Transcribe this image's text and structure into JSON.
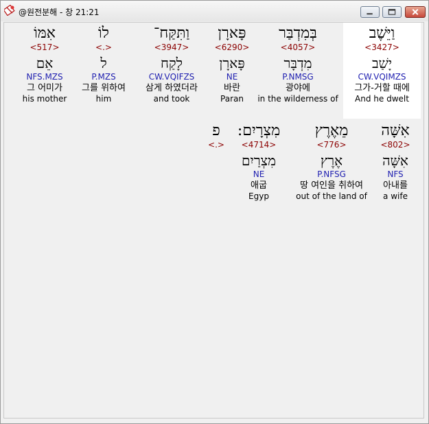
{
  "window": {
    "title": "@원전분해 - 창 21:21",
    "min_icon": "minimize-icon",
    "max_icon": "maximize-icon",
    "close_icon": "close-icon"
  },
  "colors": {
    "strong": "#8b0000",
    "parsing": "#1f1fb0",
    "selected_bg": "#ffffff"
  },
  "rows": [
    {
      "words": [
        {
          "hebrew": "וַיֵּשֶׁב",
          "strong": "<3427>",
          "lemma": "יָשַׁב",
          "parsing": "CW.VQIMZS",
          "korean": "그가-거할 때에",
          "english": "And he dwelt",
          "selected": true
        },
        {
          "hebrew": "בְּמִדְבַּר",
          "strong": "<4057>",
          "lemma": "מִדְבָּר",
          "parsing": "P.NMSG",
          "korean": "광야에",
          "english": "in the wilderness of"
        },
        {
          "hebrew": "פָּארָן",
          "strong": "<6290>",
          "lemma": "פָּארָן",
          "parsing": "NE",
          "korean": "바란",
          "english": "Paran"
        },
        {
          "hebrew": "וַתִּקַּח־",
          "strong": "<3947>",
          "lemma": "לָקַח",
          "parsing": "CW.VQIFZS",
          "korean": "삼게 하였더라",
          "english": "and took"
        },
        {
          "hebrew": "לוֹ",
          "strong": "<.>",
          "lemma": "ל",
          "parsing": "P.MZS",
          "korean": "그를 위하여",
          "english": "him"
        },
        {
          "hebrew": "אִמּוֹ",
          "strong": "<517>",
          "lemma": "אֵם",
          "parsing": "NFS.MZS",
          "korean": "그 어미가",
          "english": "his mother"
        }
      ]
    },
    {
      "words": [
        {
          "hebrew": "אִשָּׁה",
          "strong": "<802>",
          "lemma": "אִשָּׁה",
          "parsing": "NFS",
          "korean": "아내를",
          "english": "a wife"
        },
        {
          "hebrew": "מֵאֶרֶץ",
          "strong": "<776>",
          "lemma": "אֶרֶץ",
          "parsing": "P.NFSG",
          "korean": "땅 여인을 취하여",
          "english": "out of the land of"
        },
        {
          "hebrew": "מִצְרָיִם:",
          "strong": "<4714>",
          "lemma": "מִצְרַיִם",
          "parsing": "NE",
          "korean": "애굽",
          "english": "Egyp"
        },
        {
          "hebrew": "פ",
          "strong": "<.>",
          "lemma": "",
          "parsing": "",
          "korean": "",
          "english": ""
        }
      ]
    }
  ]
}
